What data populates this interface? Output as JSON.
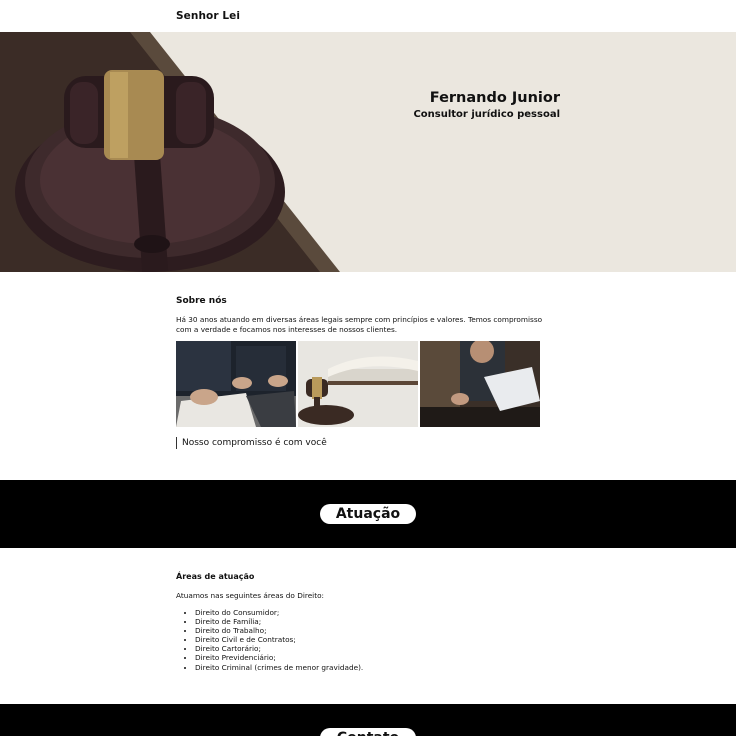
{
  "header": {
    "brand": "Senhor Lei"
  },
  "hero": {
    "name": "Fernando Junior",
    "role": "Consultor jurídico pessoal"
  },
  "about": {
    "title": "Sobre nós",
    "text": "Há 30 anos atuando em diversas áreas legais sempre com princípios e valores. Temos compromisso com a verdade e focamos nos interesses de nossos clientes.",
    "caption": "Nosso compromisso é com você"
  },
  "sections": {
    "atuacao_label": "Atuação",
    "next_label": "Contato"
  },
  "areas": {
    "title": "Áreas de atuação",
    "intro": "Atuamos nas seguintes áreas do Direito:",
    "items": [
      "Direito do Consumidor;",
      "Direito de Família;",
      "Direito do Trabalho;",
      "Direito Civil e de Contratos;",
      "Direito Cartorário;",
      "Direito Previdenciário;",
      "Direito Criminal (crimes de menor gravidade)."
    ]
  }
}
